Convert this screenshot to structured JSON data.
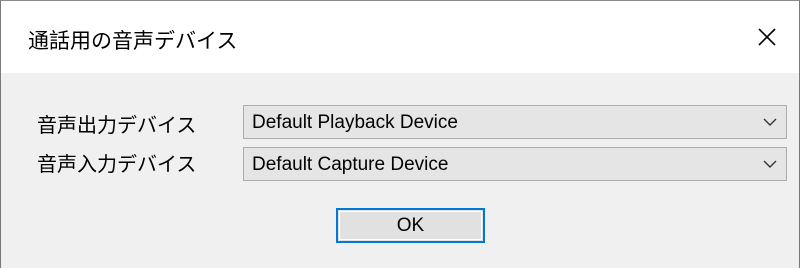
{
  "window": {
    "title": "通話用の音声デバイス",
    "close_icon": "close-icon"
  },
  "output_device": {
    "label": "音声出力デバイス",
    "selected": "Default Playback Device",
    "dropdown_icon": "chevron-down-icon"
  },
  "input_device": {
    "label": "音声入力デバイス",
    "selected": "Default Capture Device",
    "dropdown_icon": "chevron-down-icon"
  },
  "buttons": {
    "ok_label": "OK"
  },
  "colors": {
    "dialog_background": "#f0f0f0",
    "titlebar_background": "#ffffff",
    "combo_background": "#e5e5e5",
    "combo_border": "#adadad",
    "button_focus_border": "#0078d7"
  }
}
